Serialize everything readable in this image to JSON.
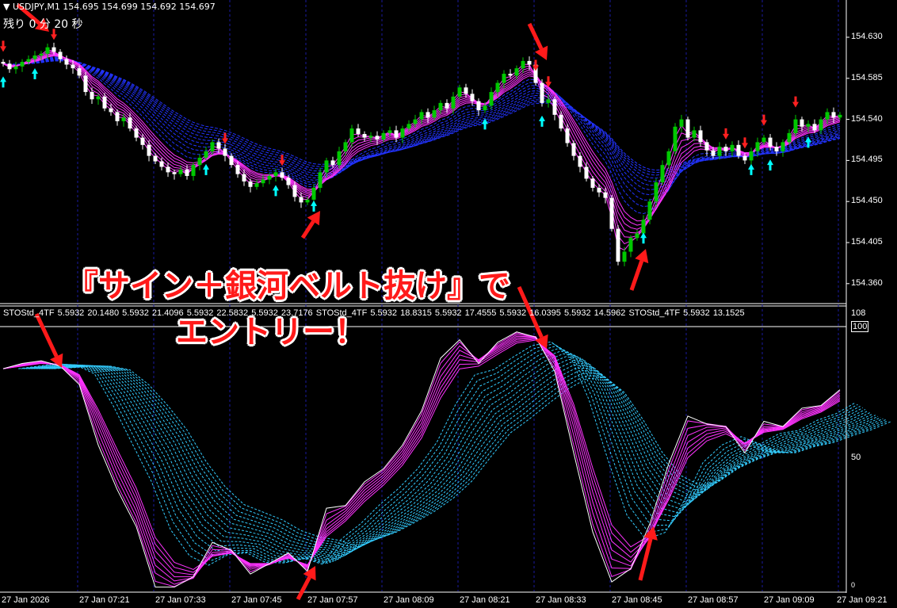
{
  "header": {
    "symbol_line": "USDJPY,M1  154.695 154.699 154.692 154.697",
    "timer": "残り 0 分 20 秒"
  },
  "indicator_label": "STOStd_4TF 5.5932 20.1480 5.5932 21.4096 5.5932 22.5832 5.5932 23.7176  STOStd_4TF 5.5932 18.8315 5.5932 17.4555 5.5932 16.0395 5.5932 14.5962  STOStd_4TF 5.5932 13.1525",
  "annotation": {
    "line1": "『サイン＋銀河ベルト抜け』で",
    "line2": "エントリー！"
  },
  "colors": {
    "bull": "#00c800",
    "bear": "#ffffff",
    "fast_band": "#ff33ff",
    "slow_band": "#2233ff",
    "stoch_slow": "#33ccff",
    "grid": "#1a1aa0",
    "signal_down": "#ff2020",
    "signal_up": "#00ffff",
    "annotation": "#ff1a1a"
  },
  "chart_data": [
    {
      "type": "candlestick",
      "symbol": "USDJPY",
      "timeframe": "M1",
      "price_axis": [
        "154.630",
        "154.585",
        "154.540",
        "154.495",
        "154.450",
        "154.405",
        "154.360"
      ],
      "ylim": [
        154.345,
        154.655
      ],
      "time_axis": [
        "27 Jan 2026",
        "27 Jan 07:21",
        "27 Jan 07:33",
        "27 Jan 07:45",
        "27 Jan 07:57",
        "27 Jan 08:09",
        "27 Jan 08:21",
        "27 Jan 08:33",
        "27 Jan 08:45",
        "27 Jan 08:57",
        "27 Jan 09:09",
        "27 Jan 09:21"
      ],
      "closes": [
        154.601,
        154.595,
        154.598,
        154.603,
        154.606,
        154.61,
        154.612,
        154.619,
        154.614,
        154.606,
        154.6,
        154.596,
        154.588,
        154.57,
        154.562,
        154.565,
        154.552,
        154.548,
        154.538,
        154.542,
        154.53,
        154.52,
        154.512,
        154.5,
        154.494,
        154.488,
        154.482,
        154.48,
        154.485,
        154.478,
        154.49,
        154.498,
        154.505,
        154.515,
        154.508,
        154.5,
        154.49,
        154.48,
        154.472,
        154.466,
        154.47,
        154.474,
        154.478,
        154.482,
        154.476,
        154.468,
        154.455,
        154.449,
        154.452,
        154.465,
        154.482,
        154.495,
        154.49,
        154.505,
        154.515,
        154.53,
        154.524,
        154.52,
        154.522,
        154.518,
        154.525,
        154.528,
        154.52,
        154.53,
        154.535,
        154.54,
        154.548,
        154.542,
        154.55,
        154.558,
        154.552,
        154.565,
        154.575,
        154.568,
        154.56,
        154.55,
        154.555,
        154.57,
        154.58,
        154.59,
        154.588,
        154.596,
        154.604,
        154.6,
        154.58,
        154.558,
        154.562,
        154.545,
        154.53,
        154.514,
        154.5,
        154.488,
        154.475,
        154.465,
        154.46,
        154.454,
        154.42,
        154.384,
        154.395,
        154.41,
        154.415,
        154.43,
        154.45,
        154.471,
        154.49,
        154.505,
        154.532,
        154.54,
        154.52,
        154.528,
        154.515,
        154.506,
        154.5,
        154.51,
        154.505,
        154.512,
        154.5,
        154.495,
        154.505,
        154.515,
        154.52,
        154.51,
        154.505,
        154.515,
        154.525,
        154.54,
        154.532,
        154.535,
        154.528,
        154.54,
        154.548,
        154.542,
        154.545
      ],
      "signals_down": [
        0,
        8,
        35,
        44,
        84,
        86,
        114,
        117,
        120,
        125
      ],
      "signals_up": [
        0,
        5,
        32,
        43,
        49,
        76,
        85,
        101,
        118,
        121,
        127
      ]
    },
    {
      "type": "line",
      "name": "STOStd_4TF",
      "y_axis": [
        "108",
        "100",
        "50",
        "0"
      ],
      "ylim": [
        0,
        108
      ],
      "values": [
        84,
        86,
        87,
        85,
        78,
        55,
        38,
        24,
        1,
        1,
        5,
        18,
        15,
        6,
        10,
        14,
        7,
        31,
        32,
        41,
        46,
        55,
        68,
        88,
        95,
        86,
        94,
        98,
        96,
        83,
        52,
        22,
        3,
        8,
        25,
        48,
        66,
        63,
        62,
        52,
        64,
        62,
        69,
        70,
        76
      ]
    }
  ]
}
